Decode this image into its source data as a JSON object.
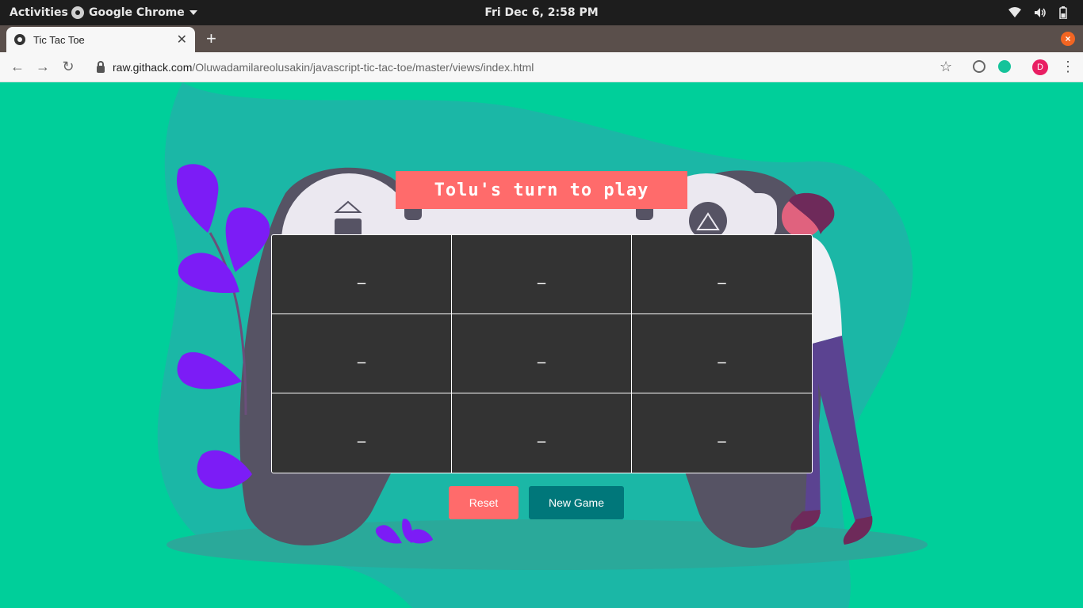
{
  "system_bar": {
    "activities": "Activities",
    "app_name": "Google Chrome",
    "clock": "Fri Dec  6,  2:58 PM"
  },
  "browser": {
    "tab_title": "Tic Tac Toe",
    "url_host": "raw.githack.com",
    "url_path": "/Oluwadamilareolusakin/javascript-tic-tac-toe/master/views/index.html",
    "profile_initial": "D",
    "window_close": "×",
    "new_tab": "+"
  },
  "game": {
    "status": "Tolu's turn to play",
    "cells": [
      "_",
      "_",
      "_",
      "_",
      "_",
      "_",
      "_",
      "_",
      "_"
    ],
    "reset_label": "Reset",
    "new_game_label": "New Game"
  },
  "colors": {
    "background": "#00cf9a",
    "status_banner": "#ff6b6b",
    "board": "#333333",
    "reset_button": "#ff6b6b",
    "new_game_button": "#00777a"
  }
}
